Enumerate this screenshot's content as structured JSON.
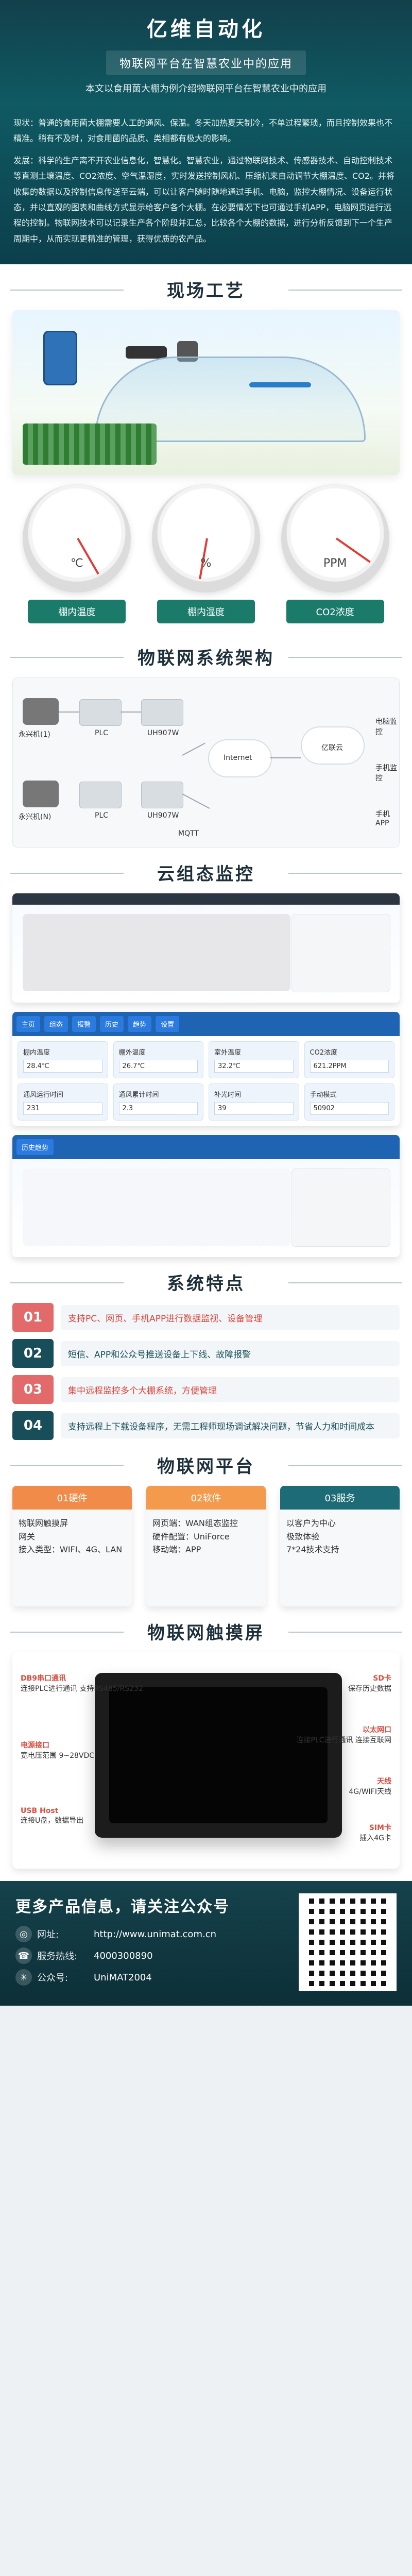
{
  "header": {
    "brand": "亿维自动化",
    "subtitle": "物联网平台在智慧农业中的应用",
    "intro": "本文以食用菌大棚为例介绍物联网平台在智慧农业中的应用"
  },
  "paragraphs": [
    "现状：普通的食用菌大棚需要人工的通风、保温。冬天加热夏天制冷，不单过程繁琐，而且控制效果也不精准。稍有不及时，对食用菌的品质、类相都有极大的影响。",
    "发展：科学的生产离不开农业信息化，智慧化。智慧农业，通过物联网技术、传感器技术、自动控制技术等直测土壤温度、CO2浓度、空气温湿度，实时发送控制风机、压缩机来自动调节大棚温度、CO2。并将收集的数据以及控制信息传送至云端，可以让客户随时随地通过手机、电脑，监控大棚情况、设备运行状态，并以直观的图表和曲线方式显示给客户各个大棚。在必要情况下也可通过手机APP，电脑网页进行远程的控制。物联网技术可以记录生产各个阶段并汇总，比较各个大棚的数据，进行分析反馈到下一个生产周期中，从而实现更精准的管理，获得优质的农产品。"
  ],
  "sections": {
    "scene": "现场工艺",
    "architecture": "物联网系统架构",
    "cloud": "云组态监控",
    "features": "系统特点",
    "platform": "物联网平台",
    "touch": "物联网触摸屏"
  },
  "scene_labels": {
    "gauge_units": [
      "℃",
      "%",
      "PPM"
    ],
    "gauge_captions": [
      "棚内温度",
      "棚内湿度",
      "CO2浓度"
    ]
  },
  "architecture_labels": {
    "left_top": "永兴机(1)",
    "left_bottom": "永兴机(N)",
    "plc": "PLC",
    "gateway": "UH907W",
    "net": "Internet",
    "cloud": "亿联云",
    "mqtt": "MQTT",
    "apps": [
      "电脑监控",
      "手机监控",
      "手机APP"
    ]
  },
  "cloud_monitor": {
    "top_tabs": [
      "主页",
      "组态",
      "报警",
      "历史",
      "趋势",
      "设置"
    ],
    "fields": [
      {
        "label": "棚内温度",
        "value": "28.4℃"
      },
      {
        "label": "棚外温度",
        "value": "26.7℃"
      },
      {
        "label": "室外温度",
        "value": "32.2℃"
      },
      {
        "label": "CO2浓度",
        "value": "621.2PPM"
      },
      {
        "label": "通风运行时间",
        "value": "231"
      },
      {
        "label": "通风累计时间",
        "value": "2.3"
      },
      {
        "label": "补光时间",
        "value": "39"
      },
      {
        "label": "手动模式",
        "value": "50902"
      }
    ],
    "history_title": "历史趋势"
  },
  "features": [
    {
      "no": "01",
      "text": "支持PC、网页、手机APP进行数据监视、设备管理"
    },
    {
      "no": "02",
      "text": "短信、APP和公众号推送设备上下线、故障报警"
    },
    {
      "no": "03",
      "text": "集中远程监控多个大棚系统，方便管理"
    },
    {
      "no": "04",
      "text": "支持远程上下载设备程序，无需工程师现场调试解决问题，节省人力和时间成本"
    }
  ],
  "platform": [
    {
      "head": "01硬件",
      "body": [
        "物联网触摸屏",
        "网关",
        "接入类型：WIFI、4G、LAN"
      ]
    },
    {
      "head": "02软件",
      "body": [
        "网页端：WAN组态监控",
        "硬件配置：UniForce",
        "移动端：APP"
      ]
    },
    {
      "head": "03服务",
      "body": [
        "以客户为中心",
        "极致体验",
        "7*24技术支持"
      ]
    }
  ],
  "touch_labels": [
    {
      "title": "DB9串口通讯",
      "desc": "连接PLC进行通讯\n支持RS485/RS232"
    },
    {
      "title": "电源接口",
      "desc": "宽电压范围\n9~28VDC"
    },
    {
      "title": "USB Host",
      "desc": "连接U盘，数据导出"
    },
    {
      "title": "SD卡",
      "desc": "保存历史数据"
    },
    {
      "title": "以太网口",
      "desc": "连接PLC进行通讯\n连接互联网"
    },
    {
      "title": "天线",
      "desc": "4G/WIFI天线"
    },
    {
      "title": "SIM卡",
      "desc": "插入4G卡"
    }
  ],
  "footer": {
    "title": "更多产品信息，请关注公众号",
    "website_label": "网址:",
    "website": "http://www.unimat.com.cn",
    "phone_label": "服务热线:",
    "phone": "4000300890",
    "account_label": "公众号:",
    "account": "UniMAT2004"
  }
}
